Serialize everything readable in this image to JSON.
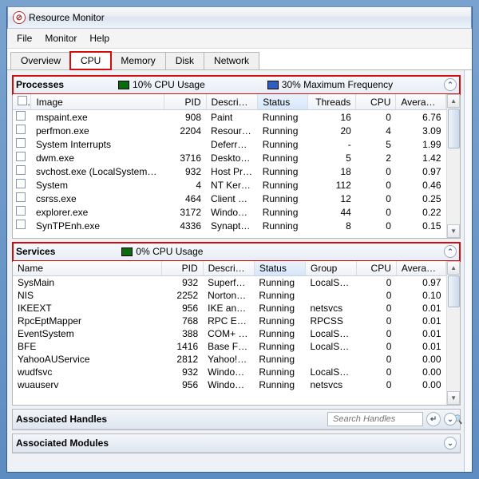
{
  "window": {
    "title": "Resource Monitor"
  },
  "menu": {
    "file": "File",
    "monitor": "Monitor",
    "help": "Help"
  },
  "tabs": {
    "overview": "Overview",
    "cpu": "CPU",
    "memory": "Memory",
    "disk": "Disk",
    "network": "Network",
    "active": "cpu"
  },
  "processes_panel": {
    "title": "Processes",
    "cpu_usage_label": "10% CPU Usage",
    "max_freq_label": "30% Maximum Frequency",
    "cpu_swatch": "#0b6b0b",
    "freq_swatch": "#2b5fc0",
    "columns": {
      "image": "Image",
      "pid": "PID",
      "description": "Descrip…",
      "status": "Status",
      "threads": "Threads",
      "cpu": "CPU",
      "avg": "Averag…"
    },
    "rows": [
      {
        "image": "mspaint.exe",
        "pid": "908",
        "desc": "Paint",
        "status": "Running",
        "threads": "16",
        "cpu": "0",
        "avg": "6.76"
      },
      {
        "image": "perfmon.exe",
        "pid": "2204",
        "desc": "Resour…",
        "status": "Running",
        "threads": "20",
        "cpu": "4",
        "avg": "3.09"
      },
      {
        "image": "System Interrupts",
        "pid": "",
        "desc": "Deferr…",
        "status": "Running",
        "threads": "-",
        "cpu": "5",
        "avg": "1.99"
      },
      {
        "image": "dwm.exe",
        "pid": "3716",
        "desc": "Deskto…",
        "status": "Running",
        "threads": "5",
        "cpu": "2",
        "avg": "1.42"
      },
      {
        "image": "svchost.exe (LocalSystemNet…",
        "pid": "932",
        "desc": "Host Pr…",
        "status": "Running",
        "threads": "18",
        "cpu": "0",
        "avg": "0.97"
      },
      {
        "image": "System",
        "pid": "4",
        "desc": "NT Ker…",
        "status": "Running",
        "threads": "112",
        "cpu": "0",
        "avg": "0.46"
      },
      {
        "image": "csrss.exe",
        "pid": "464",
        "desc": "Client …",
        "status": "Running",
        "threads": "12",
        "cpu": "0",
        "avg": "0.25"
      },
      {
        "image": "explorer.exe",
        "pid": "3172",
        "desc": "Windo…",
        "status": "Running",
        "threads": "44",
        "cpu": "0",
        "avg": "0.22"
      },
      {
        "image": "SynTPEnh.exe",
        "pid": "4336",
        "desc": "Synapt…",
        "status": "Running",
        "threads": "8",
        "cpu": "0",
        "avg": "0.15"
      }
    ]
  },
  "services_panel": {
    "title": "Services",
    "cpu_usage_label": "0% CPU Usage",
    "cpu_swatch": "#0b6b0b",
    "columns": {
      "name": "Name",
      "pid": "PID",
      "description": "Descrip…",
      "status": "Status",
      "group": "Group",
      "cpu": "CPU",
      "avg": "Averag…"
    },
    "rows": [
      {
        "name": "SysMain",
        "pid": "932",
        "desc": "Superf…",
        "status": "Running",
        "group": "LocalS…",
        "cpu": "0",
        "avg": "0.97"
      },
      {
        "name": "NIS",
        "pid": "2252",
        "desc": "Norton…",
        "status": "Running",
        "group": "",
        "cpu": "0",
        "avg": "0.10"
      },
      {
        "name": "IKEEXT",
        "pid": "956",
        "desc": "IKE an…",
        "status": "Running",
        "group": "netsvcs",
        "cpu": "0",
        "avg": "0.01"
      },
      {
        "name": "RpcEptMapper",
        "pid": "768",
        "desc": "RPC En…",
        "status": "Running",
        "group": "RPCSS",
        "cpu": "0",
        "avg": "0.01"
      },
      {
        "name": "EventSystem",
        "pid": "388",
        "desc": "COM+ …",
        "status": "Running",
        "group": "LocalS…",
        "cpu": "0",
        "avg": "0.01"
      },
      {
        "name": "BFE",
        "pid": "1416",
        "desc": "Base Fi…",
        "status": "Running",
        "group": "LocalS…",
        "cpu": "0",
        "avg": "0.01"
      },
      {
        "name": "YahooAUService",
        "pid": "2812",
        "desc": "Yahoo!…",
        "status": "Running",
        "group": "",
        "cpu": "0",
        "avg": "0.00"
      },
      {
        "name": "wudfsvc",
        "pid": "932",
        "desc": "Windo…",
        "status": "Running",
        "group": "LocalS…",
        "cpu": "0",
        "avg": "0.00"
      },
      {
        "name": "wuauserv",
        "pid": "956",
        "desc": "Windo…",
        "status": "Running",
        "group": "netsvcs",
        "cpu": "0",
        "avg": "0.00"
      }
    ]
  },
  "handles_panel": {
    "title": "Associated Handles",
    "search_placeholder": "Search Handles"
  },
  "modules_panel": {
    "title": "Associated Modules"
  }
}
